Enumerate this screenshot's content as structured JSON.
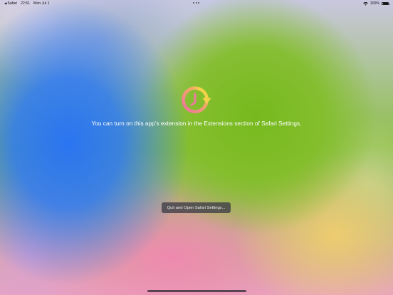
{
  "status_bar": {
    "back_app": "Safari",
    "back_arrow": "◀",
    "time": "22:51",
    "date": "Mon Jul 1",
    "battery_percent": "100%",
    "battery_level": 1.0
  },
  "main": {
    "message": "You can turn on this app’s extension in the Extensions section of Safari Settings.",
    "quit_button_label": "Quit and Open Safari Settings..."
  },
  "icons": {
    "app_icon": "clock-refresh-icon",
    "wifi": "wifi-icon",
    "battery": "battery-icon",
    "multitask": "multitasking-dots-icon"
  },
  "colors": {
    "message_text": "#ffffff",
    "button_background": "#3c3c46",
    "icon_gradient_start": "#f07aa5",
    "icon_gradient_end": "#f2d24a"
  }
}
